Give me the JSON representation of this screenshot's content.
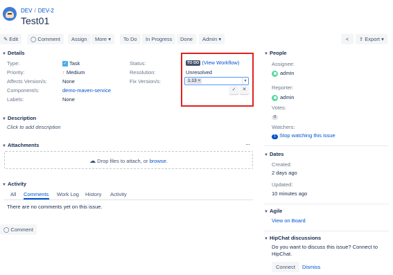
{
  "breadcrumb": {
    "project": "DEV",
    "issue": "DEV-2"
  },
  "issue": {
    "title": "Test01"
  },
  "toolbar": {
    "edit": "Edit",
    "comment": "Comment",
    "assign": "Assign",
    "more": "More",
    "todo": "To Do",
    "in_progress": "In Progress",
    "done": "Done",
    "admin": "Admin",
    "export": "Export"
  },
  "details": {
    "heading": "Details",
    "type_label": "Type:",
    "type_value": "Task",
    "priority_label": "Priority:",
    "priority_value": "Medium",
    "affects_label": "Affects Version/s:",
    "affects_value": "None",
    "component_label": "Component/s:",
    "component_value": "demo-maven-service",
    "labels_label": "Labels:",
    "labels_value": "None",
    "status_label": "Status:",
    "status_value": "TO DO",
    "view_workflow": "(View Workflow)",
    "resolution_label": "Resolution:",
    "resolution_value": "Unresolved",
    "fix_label": "Fix Version/s:",
    "fix_tag": "1.13"
  },
  "description": {
    "heading": "Description",
    "placeholder": "Click to add description"
  },
  "attachments": {
    "heading": "Attachments",
    "drop_text": "Drop files to attach, or",
    "browse": "browse."
  },
  "activity": {
    "heading": "Activity",
    "tabs": [
      "All",
      "Comments",
      "Work Log",
      "History",
      "Activity"
    ],
    "empty": "There are no comments yet on this issue.",
    "comment_button": "Comment"
  },
  "people": {
    "heading": "People",
    "assignee_label": "Assignee:",
    "assignee": "admin",
    "reporter_label": "Reporter:",
    "reporter": "admin",
    "votes_label": "Votes:",
    "votes": "0",
    "watchers_label": "Watchers:",
    "watchers": "1",
    "stop_watching": "Stop watching this issue"
  },
  "dates": {
    "heading": "Dates",
    "created_label": "Created:",
    "created": "2 days ago",
    "updated_label": "Updated:",
    "updated": "10 minutes ago"
  },
  "agile": {
    "heading": "Agile",
    "view_board": "View on Board"
  },
  "hipchat": {
    "heading": "HipChat discussions",
    "text": "Do you want to discuss this issue? Connect to HipChat.",
    "connect": "Connect",
    "dismiss": "Dismiss"
  },
  "colors": {
    "accent": "#0052cc",
    "highlight_border": "#e02020"
  }
}
